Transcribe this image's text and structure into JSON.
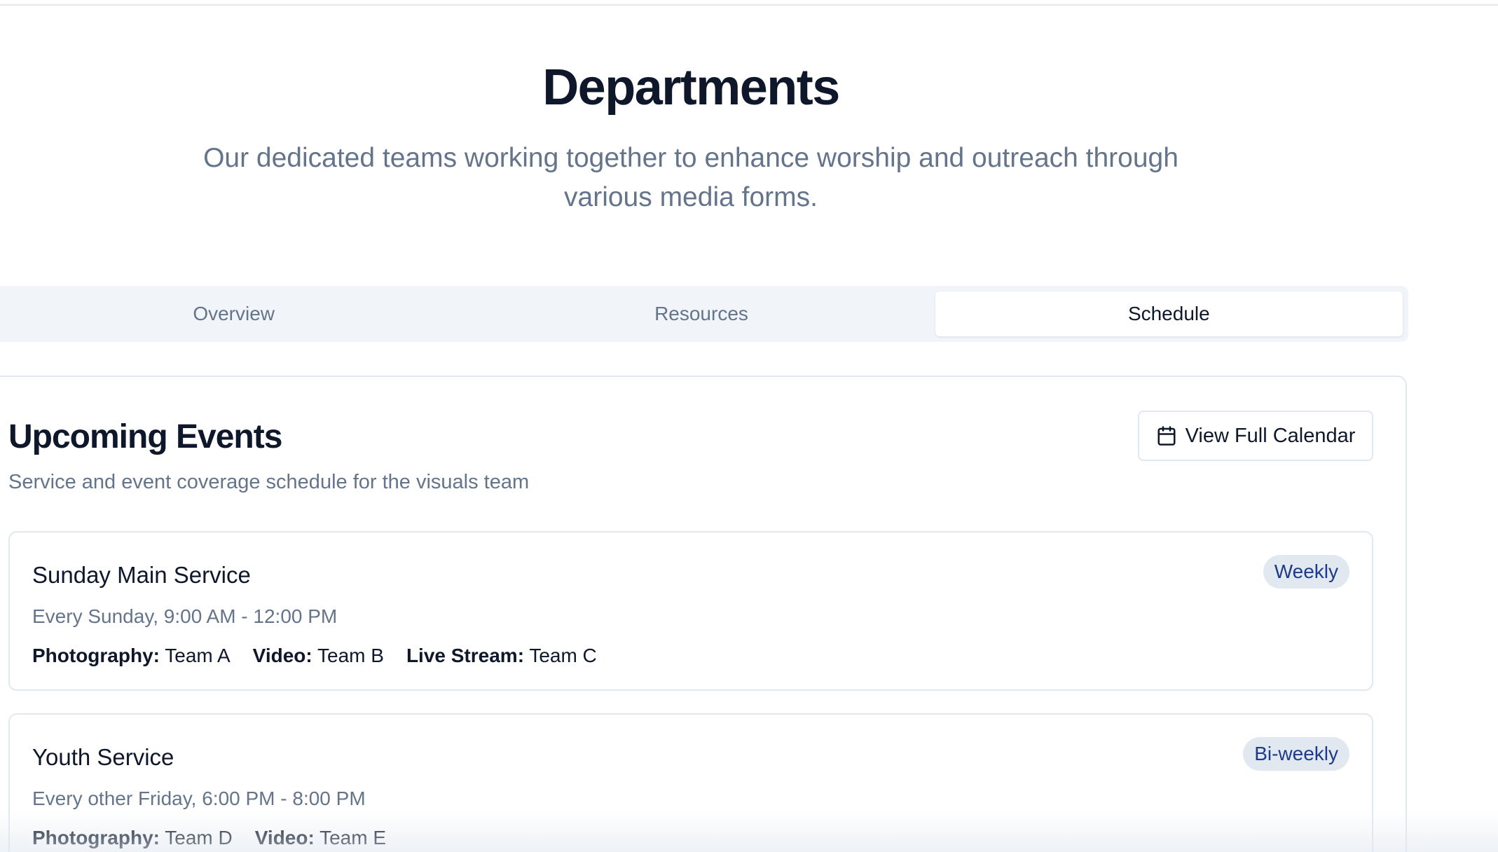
{
  "header": {
    "title": "Departments",
    "subtitle_line1": "Our dedicated teams working together to enhance worship and outreach through",
    "subtitle_line2": "various media forms."
  },
  "tabs": [
    {
      "label": "Overview",
      "active": false
    },
    {
      "label": "Resources",
      "active": false
    },
    {
      "label": "Schedule",
      "active": true
    }
  ],
  "schedule": {
    "title": "Upcoming Events",
    "description": "Service and event coverage schedule for the visuals team",
    "calendar_button": {
      "label": "View Full Calendar",
      "icon": "calendar-icon"
    },
    "events": [
      {
        "name": "Sunday Main Service",
        "time": "Every Sunday, 9:00 AM - 12:00 PM",
        "frequency": "Weekly",
        "assignments": [
          {
            "role": "Photography:",
            "team": "Team A"
          },
          {
            "role": "Video:",
            "team": "Team B"
          },
          {
            "role": "Live Stream:",
            "team": "Team C"
          }
        ]
      },
      {
        "name": "Youth Service",
        "time": "Every other Friday, 6:00 PM - 8:00 PM",
        "frequency": "Bi-weekly",
        "assignments": [
          {
            "role": "Photography:",
            "team": "Team D"
          },
          {
            "role": "Video:",
            "team": "Team E"
          }
        ]
      }
    ]
  },
  "colors": {
    "heading": "#0f172a",
    "muted": "#64748b",
    "tab_bar": "#f1f5f9",
    "border": "#e2e8f0",
    "badge_text": "#1e3a8a"
  }
}
